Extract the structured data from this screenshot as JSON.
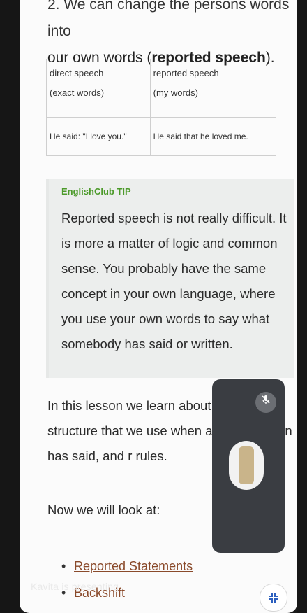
{
  "intro": {
    "cut_line": "2. We can change the persons words into",
    "line_prefix": "our own words (",
    "line_bold": "reported speech",
    "line_suffix": ")."
  },
  "table": {
    "headers": [
      {
        "line1": "direct speech",
        "line2": "(exact words)"
      },
      {
        "line1": "reported speech",
        "line2": "(my words)"
      }
    ],
    "row": [
      "He said: \"I love you.\"",
      "He said that he loved me."
    ]
  },
  "tip": {
    "label": "EnglishClub TIP",
    "text": "Reported speech is not really difficult. It is more a matter of logic and common sense. You probably have the same concept in your own language, where you use your own words to say what somebody has said or written."
  },
  "body": {
    "prefix": "In this lesson we learn about ",
    "bold": "re",
    "rest": " the structure that we use when another person has said, and r rules."
  },
  "now": "Now we will look at:",
  "list": [
    {
      "label": "Reported Statements"
    },
    {
      "label": "Backshift"
    }
  ],
  "overlay": {
    "presenting_text": "Kavita is presenting",
    "mic_icon": "mic-off-icon",
    "fab_icon": "collapse-icon"
  }
}
